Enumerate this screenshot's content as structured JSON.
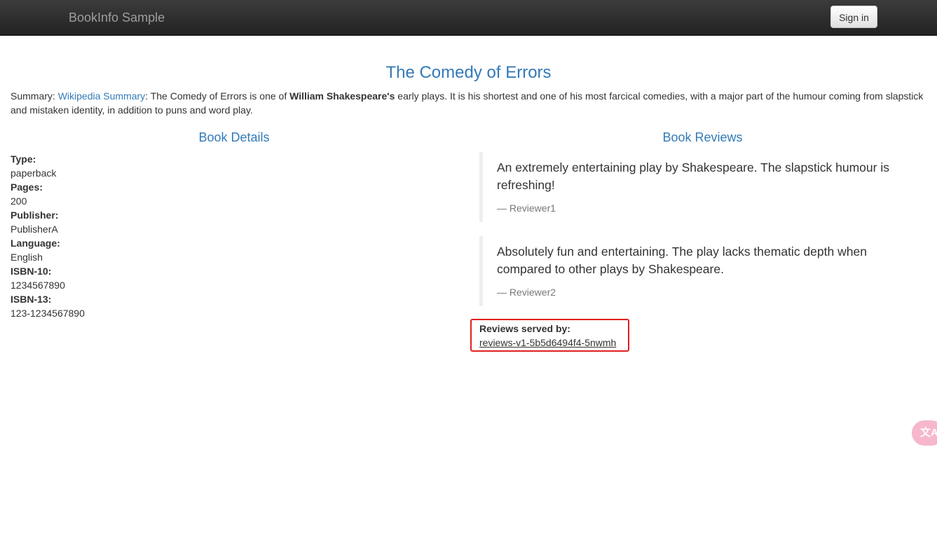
{
  "navbar": {
    "brand": "BookInfo Sample",
    "sign_in_label": "Sign in"
  },
  "book": {
    "title": "The Comedy of Errors",
    "summary_prefix": "Summary: ",
    "summary_link": "Wikipedia Summary",
    "summary_text_1": ": The Comedy of Errors is one of ",
    "summary_author": "William Shakespeare's",
    "summary_text_2": " early plays. It is his shortest and one of his most farcical comedies, with a major part of the humour coming from slapstick and mistaken identity, in addition to puns and word play."
  },
  "details": {
    "heading": "Book Details",
    "fields": [
      {
        "label": "Type:",
        "value": "paperback"
      },
      {
        "label": "Pages:",
        "value": "200"
      },
      {
        "label": "Publisher:",
        "value": "PublisherA"
      },
      {
        "label": "Language:",
        "value": "English"
      },
      {
        "label": "ISBN-10:",
        "value": "1234567890"
      },
      {
        "label": "ISBN-13:",
        "value": "123-1234567890"
      }
    ]
  },
  "reviews": {
    "heading": "Book Reviews",
    "items": [
      {
        "text": "An extremely entertaining play by Shakespeare. The slapstick humour is refreshing!",
        "reviewer": "— Reviewer1"
      },
      {
        "text": "Absolutely fun and entertaining. The play lacks thematic depth when compared to other plays by Shakespeare.",
        "reviewer": "— Reviewer2"
      }
    ],
    "served_by_label": "Reviews served by:",
    "served_by_pod": "reviews-v1-5b5d6494f4-5nwmh"
  },
  "translate_widget": {
    "icon": "translate-icon",
    "glyph": "文A"
  },
  "colors": {
    "accent": "#337ab7",
    "highlight_border": "#e02020",
    "navbar": "#222222"
  }
}
